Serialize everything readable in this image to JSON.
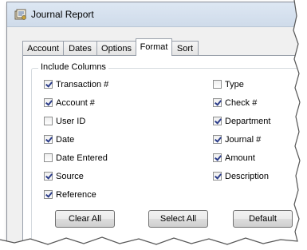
{
  "window": {
    "title": "Journal Report",
    "icon": "journal-report-icon"
  },
  "tabs": [
    {
      "label": "Account",
      "active": false
    },
    {
      "label": "Dates",
      "active": false
    },
    {
      "label": "Options",
      "active": false
    },
    {
      "label": "Format",
      "active": true
    },
    {
      "label": "Sort",
      "active": false
    }
  ],
  "group": {
    "title": "Include Columns",
    "left_column": [
      {
        "label": "Transaction #",
        "checked": true
      },
      {
        "label": "Account #",
        "checked": true
      },
      {
        "label": "User ID",
        "checked": false
      },
      {
        "label": "Date",
        "checked": true
      },
      {
        "label": "Date Entered",
        "checked": false
      },
      {
        "label": "Source",
        "checked": true
      },
      {
        "label": "Reference",
        "checked": true
      }
    ],
    "right_column": [
      {
        "label": "Type",
        "checked": false
      },
      {
        "label": "Check #",
        "checked": true
      },
      {
        "label": "Department",
        "checked": true
      },
      {
        "label": "Journal #",
        "checked": true
      },
      {
        "label": "Amount",
        "checked": true
      },
      {
        "label": "Description",
        "checked": true
      }
    ]
  },
  "buttons": {
    "clear_all": "Clear All",
    "select_all": "Select All",
    "default": "Default"
  },
  "colors": {
    "titlebar": "#d6e1ee",
    "checkmark": "#2d3e8a",
    "panel_border": "#9aa1ab"
  }
}
